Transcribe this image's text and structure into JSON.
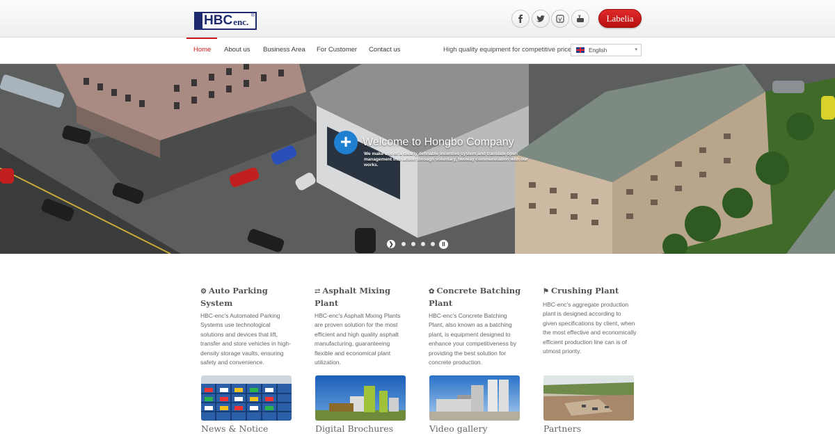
{
  "header": {
    "logo_text": "HBC",
    "logo_sub": "enc.",
    "logo_reg": "®",
    "social_icons": [
      "facebook-icon",
      "twitter-icon",
      "vimeo-icon",
      "youtube-icon"
    ],
    "labelia_label": "Labelia"
  },
  "nav": {
    "items": [
      {
        "label": "Home",
        "active": true
      },
      {
        "label": "About us",
        "active": false
      },
      {
        "label": "Business Area",
        "active": false
      },
      {
        "label": "For Customer",
        "active": false
      },
      {
        "label": "Contact us",
        "active": false
      }
    ],
    "tagline": "High quality equipment for competitive price",
    "language": "English"
  },
  "hero": {
    "title": "Welcome to Hongbo Company",
    "text": "We make use of a clearly  definable incentive system and translate open management into action through voluntary, twoway communication with our works.",
    "slide_count": 4
  },
  "features": [
    {
      "icon": "gears-icon",
      "title": "Auto Parking System",
      "text": "HBC-enc's Automated Parking Systems use technological solutions and devices that lift, transfer and store vehicles in high-density storage vaults, ensuring safety and convenience."
    },
    {
      "icon": "shuffle-icon",
      "title": "Asphalt Mixing Plant",
      "text": "HBC-enc's Asphalt Mixing Plants are proven solution for the most efficient and high quality asphalt manufacturing, guaranteeing flexible and economical plant utilization."
    },
    {
      "icon": "leaf-icon",
      "title": "Concrete Batching Plant",
      "text": "HBC-enc's Concrete Batching Plant, also known as a batching plant, is equipment designed to enhance your competitiveness by providing the best solution for concrete production."
    },
    {
      "icon": "flag-icon",
      "title": "Crushing Plant",
      "text": "HBC-enc's aggregate production plant is designed according to given specifications by client, when the most effective and economically efficient production line can is of utmost priority."
    }
  ],
  "thumbs": [
    {
      "label": "News & Notice"
    },
    {
      "label": "Digital Brochures"
    },
    {
      "label": "Video gallery"
    },
    {
      "label": "Partners"
    }
  ]
}
